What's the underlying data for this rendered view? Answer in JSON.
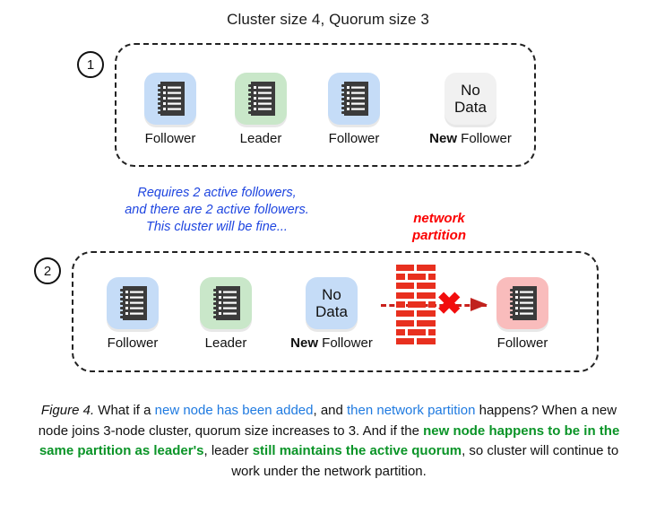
{
  "title": "Cluster size 4, Quorum size 3",
  "steps": [
    {
      "number": "1",
      "nodes": [
        {
          "label_bold": "",
          "label": "Follower",
          "tile": "blue",
          "icon": "ledger-icon",
          "text": ""
        },
        {
          "label_bold": "",
          "label": "Leader",
          "tile": "green",
          "icon": "ledger-icon",
          "text": ""
        },
        {
          "label_bold": "",
          "label": "Follower",
          "tile": "blue",
          "icon": "ledger-icon",
          "text": ""
        },
        {
          "label_bold": "New",
          "label": " Follower",
          "tile": "gray",
          "icon": "no-data-text",
          "text": "No Data"
        }
      ]
    },
    {
      "number": "2",
      "nodes_left": [
        {
          "label_bold": "",
          "label": "Follower",
          "tile": "blue",
          "icon": "ledger-icon",
          "text": ""
        },
        {
          "label_bold": "",
          "label": "Leader",
          "tile": "green",
          "icon": "ledger-icon",
          "text": ""
        },
        {
          "label_bold": "New",
          "label": " Follower",
          "tile": "blue",
          "icon": "no-data-text",
          "text": "No Data"
        }
      ],
      "nodes_right": [
        {
          "label_bold": "",
          "label": "Follower",
          "tile": "pink",
          "icon": "ledger-icon",
          "text": ""
        }
      ]
    }
  ],
  "annotation_blue": {
    "line1": "Requires 2 active followers,",
    "line2": "and there are 2 active followers.",
    "line3": "This cluster will be fine..."
  },
  "annotation_red": {
    "line1": "network",
    "line2": "partition"
  },
  "partition": {
    "x_mark": "✖",
    "brick_icon": "brick-wall-icon",
    "arrow_icon": "arrow-right-icon"
  },
  "caption": {
    "figure": "Figure 4.",
    "t1": " What if a ",
    "blue1": "new node has been added",
    "t2": ", and ",
    "blue2": "then network partition",
    "t3": " happens? When a new node joins 3-node cluster, quorum size increases to 3. And if the ",
    "green1": "new node happens to be in the same partition as leader's",
    "t4": ", leader ",
    "green2": "still maintains the active quorum",
    "t5": ", so cluster will continue to work under the network partition."
  },
  "colors": {
    "blue_tile": "#c5dcf7",
    "green_tile": "#c9e7c9",
    "gray_tile": "#f1f1f1",
    "pink_tile": "#f9bcbc",
    "annotation_blue": "#1f46e0",
    "annotation_red": "#fb0000",
    "caption_blue": "#1f7ae0",
    "caption_green": "#0a9427",
    "brick": "#e8301f"
  }
}
